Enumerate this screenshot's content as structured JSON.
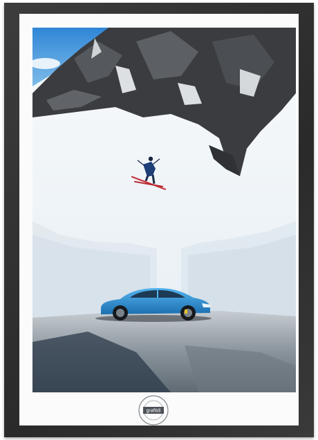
{
  "poster": {
    "frame_color": "#333333",
    "mat_color": "#fbfbfb",
    "edition_mark": "",
    "stamp": {
      "brand": "grafitdi",
      "ring_text": "",
      "icon": "seal-stamp-icon"
    }
  },
  "photo": {
    "subjects": [
      "mountain-peak-icon",
      "skier-icon",
      "sports-car-icon"
    ],
    "car_color": "#2a8fd0",
    "sky_color": "#4a9fe0"
  }
}
